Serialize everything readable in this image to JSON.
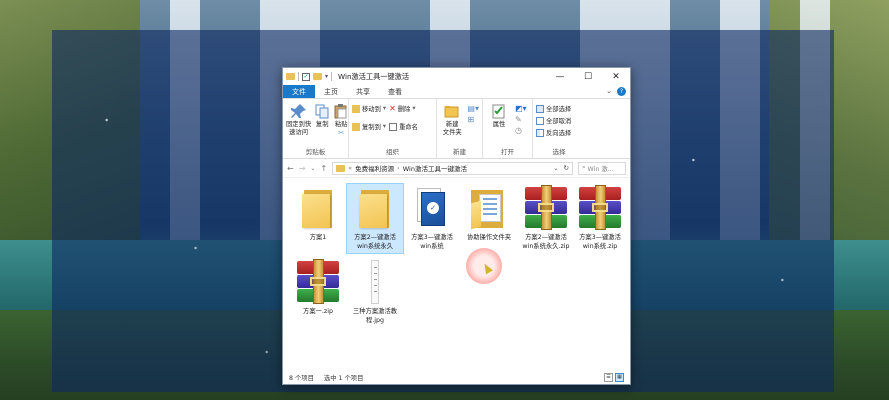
{
  "window": {
    "title": "Win激活工具一键激活",
    "controls": {
      "minimize": "—",
      "maximize": "☐",
      "close": "✕"
    }
  },
  "tabs": [
    "文件",
    "主页",
    "共享",
    "查看"
  ],
  "ribbon": {
    "clipboard": {
      "group_label": "剪贴板",
      "pin_label": "固定到快\n速访问",
      "copy_label": "复制",
      "paste_label": "粘贴"
    },
    "organize": {
      "group_label": "组织",
      "move_to": "移动到",
      "copy_to": "复制到",
      "delete": "删除",
      "rename": "重命名"
    },
    "new": {
      "group_label": "新建",
      "new_folder": "新建\n文件夹"
    },
    "open": {
      "group_label": "打开",
      "properties": "属性"
    },
    "select": {
      "group_label": "选择",
      "select_all": "全部选择",
      "select_none": "全部取消",
      "invert": "反向选择"
    }
  },
  "address": {
    "crumbs": [
      "免费福利资源",
      "Win激活工具一键激活"
    ],
    "search_placeholder": "Win 激..."
  },
  "files": [
    {
      "name": "方案1",
      "kind": "folder",
      "selected": false
    },
    {
      "name": "方案2—键激活\nwin系统永久",
      "kind": "folder",
      "selected": true
    },
    {
      "name": "方案3—键激活\nwin系统",
      "kind": "setup",
      "selected": false
    },
    {
      "name": "协助操作文件夹",
      "kind": "docfolder",
      "selected": false
    },
    {
      "name": "方案2—键激活\nwin系统永久.zip",
      "kind": "rar",
      "selected": false
    },
    {
      "name": "方案3—键激活\nwin系统.zip",
      "kind": "rar",
      "selected": false
    },
    {
      "name": "方案一.zip",
      "kind": "rar",
      "selected": false
    },
    {
      "name": "三种方案激活教\n程.jpg",
      "kind": "jpg",
      "selected": false
    }
  ],
  "status": {
    "count": "8 个项目",
    "selected": "选中 1 个项目"
  },
  "colors": {
    "file_tab": "#1979ca",
    "selection": "#cce8ff",
    "folder": "#f2c452"
  }
}
